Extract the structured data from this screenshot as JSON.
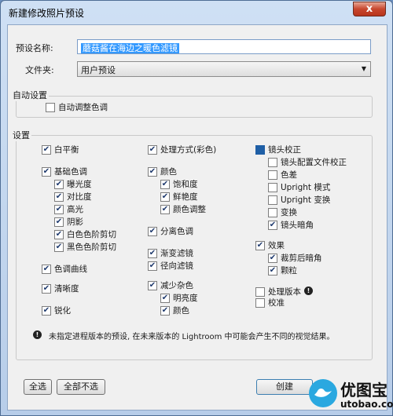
{
  "window": {
    "title": "新建修改照片预设",
    "close_glyph": "x"
  },
  "form": {
    "name_label": "预设名称:",
    "name_value": "蘑菇酱在海边之暖色滤镜",
    "folder_label": "文件夹:",
    "folder_value": "用户预设"
  },
  "auto_settings": {
    "label": "自动设置",
    "auto_tone": {
      "label": "自动调整色调",
      "checked": false
    }
  },
  "settings": {
    "label": "设置",
    "col1": [
      {
        "label": "白平衡",
        "checked": true
      },
      {
        "label": "基础色调",
        "checked": true
      },
      {
        "label": "曝光度",
        "checked": true
      },
      {
        "label": "对比度",
        "checked": true
      },
      {
        "label": "高光",
        "checked": true
      },
      {
        "label": "阴影",
        "checked": true
      },
      {
        "label": "白色色阶剪切",
        "checked": true
      },
      {
        "label": "黑色色阶剪切",
        "checked": true
      },
      {
        "label": "色调曲线",
        "checked": true
      },
      {
        "label": "清晰度",
        "checked": true
      },
      {
        "label": "锐化",
        "checked": true
      }
    ],
    "col2": [
      {
        "label": "处理方式(彩色)",
        "checked": true
      },
      {
        "label": "颜色",
        "checked": true
      },
      {
        "label": "饱和度",
        "checked": true
      },
      {
        "label": "鲜艳度",
        "checked": true
      },
      {
        "label": "颜色调整",
        "checked": true
      },
      {
        "label": "分离色调",
        "checked": true
      },
      {
        "label": "渐变滤镜",
        "checked": true
      },
      {
        "label": "径向滤镜",
        "checked": true
      },
      {
        "label": "减少杂色",
        "checked": true
      },
      {
        "label": "明亮度",
        "checked": true
      },
      {
        "label": "颜色",
        "checked": true
      }
    ],
    "col3": [
      {
        "label": "镜头校正",
        "checked": "partial"
      },
      {
        "label": "镜头配置文件校正",
        "checked": false
      },
      {
        "label": "色差",
        "checked": false
      },
      {
        "label": "Upright 模式",
        "checked": false
      },
      {
        "label": "Upright 变换",
        "checked": false
      },
      {
        "label": "变换",
        "checked": false
      },
      {
        "label": "镜头暗角",
        "checked": true
      },
      {
        "label": "效果",
        "checked": true
      },
      {
        "label": "裁剪后暗角",
        "checked": true
      },
      {
        "label": "颗粒",
        "checked": true
      },
      {
        "label": "处理版本",
        "checked": false
      },
      {
        "label": "校准",
        "checked": false
      }
    ],
    "note": "未指定进程版本的预设, 在未来版本的 Lightroom 中可能会产生不同的视觉结果。"
  },
  "buttons": {
    "select_all": "全选",
    "select_none": "全部不选",
    "create": "创建"
  },
  "watermark": {
    "brand": "优图宝",
    "url": "utobao.com"
  },
  "colors": {
    "accent": "#1f5fa6",
    "selection": "#3399ff",
    "title_bg": "#cfe0f4",
    "close": "#c7472e"
  }
}
